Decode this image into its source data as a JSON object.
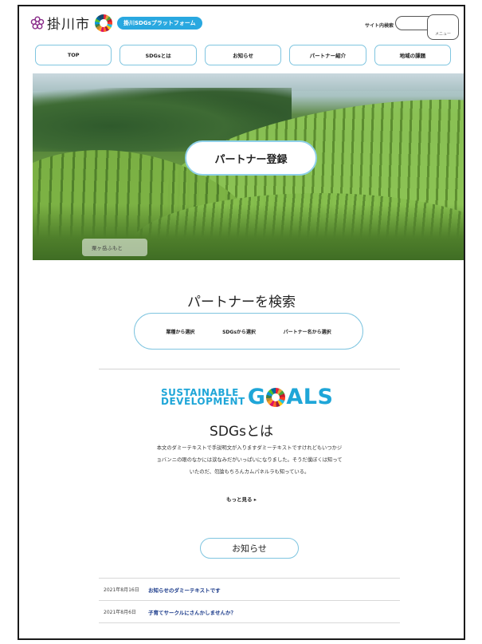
{
  "header": {
    "city": "掛川市",
    "platform_badge": "掛川SDGsプラットフォーム",
    "search_label": "サイト内検索",
    "search_value": "",
    "menu_label": "メニュー"
  },
  "nav": [
    "TOP",
    "SDGsとは",
    "お知らせ",
    "パートナー紹介",
    "地域の課題"
  ],
  "hero": {
    "register_label": "パートナー登録",
    "caption": "粟ヶ岳ふもと"
  },
  "partner_search": {
    "title": "パートナーを検索",
    "options": [
      "業種から選択",
      "SDGsから選択",
      "パートナー名から選択"
    ]
  },
  "sdgs": {
    "logo_small_1": "SUSTAINABLE",
    "logo_small_2": "DEVELOPMENT",
    "logo_big_g": "G",
    "logo_big_rest": "ALS",
    "title": "SDGsとは",
    "body_1": "本文のダミーテキストで手説明文が入りますダミーテキストですけれどもいつかジ",
    "body_2": "ョバンニの眼のなかには涙なみだがいっぱいになりました。そうだ僕ぼくは知って",
    "body_3": "いたのだ、勿論もちろんカムパネルラも知っている。",
    "more": "もっと見る ▸"
  },
  "news": {
    "button_label": "お知らせ",
    "items": [
      {
        "date": "2021年8月16日",
        "title": "お知らせのダミーテキストです"
      },
      {
        "date": "2021年8月6日",
        "title": "子育てサークルにさんかしませんか？"
      }
    ]
  },
  "colors": {
    "accent": "#29a8e0",
    "border": "#7fc5e0",
    "link": "#1a3a8a"
  }
}
